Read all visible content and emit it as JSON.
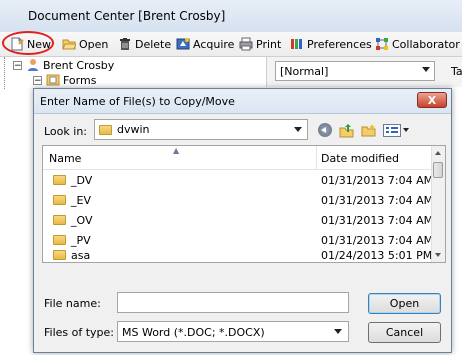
{
  "app": {
    "title": "Document Center [Brent Crosby]",
    "toolbar": [
      {
        "label": "New",
        "icon": "new-document-icon"
      },
      {
        "label": "Open",
        "icon": "open-folder-icon"
      },
      {
        "label": "Delete",
        "icon": "trash-icon"
      },
      {
        "label": "Acquire",
        "icon": "acquire-icon"
      },
      {
        "label": "Print",
        "icon": "printer-icon"
      },
      {
        "label": "Preferences",
        "icon": "preferences-icon"
      },
      {
        "label": "Collaborator",
        "icon": "collaborator-icon"
      }
    ],
    "tree": [
      {
        "label": "Brent Crosby"
      },
      {
        "label": "Forms"
      }
    ],
    "style_combo": "[Normal]",
    "right_label": "Ta"
  },
  "dialog": {
    "title": "Enter Name of File(s) to Copy/Move",
    "close_label": "X",
    "look_in_label": "Look in:",
    "look_in_value": "dvwin",
    "columns": {
      "name": "Name",
      "date": "Date modified"
    },
    "files": [
      {
        "name": "_DV",
        "date": "01/31/2013 7:04 AM"
      },
      {
        "name": "_EV",
        "date": "01/31/2013 7:04 AM"
      },
      {
        "name": "_OV",
        "date": "01/31/2013 7:04 AM"
      },
      {
        "name": "_PV",
        "date": "01/31/2013 7:04 AM"
      },
      {
        "name": "asa",
        "date": "01/24/2013 5:01 PM"
      }
    ],
    "file_name_label": "File name:",
    "file_name_value": "",
    "files_of_type_label": "Files of type:",
    "files_of_type_value": "MS Word (*.DOC; *.DOCX)",
    "open_label": "Open",
    "cancel_label": "Cancel"
  },
  "colors": {
    "highlight_circle": "#e02020",
    "title_gradient": "#dbe6f3",
    "close_button": "#c7432a"
  }
}
